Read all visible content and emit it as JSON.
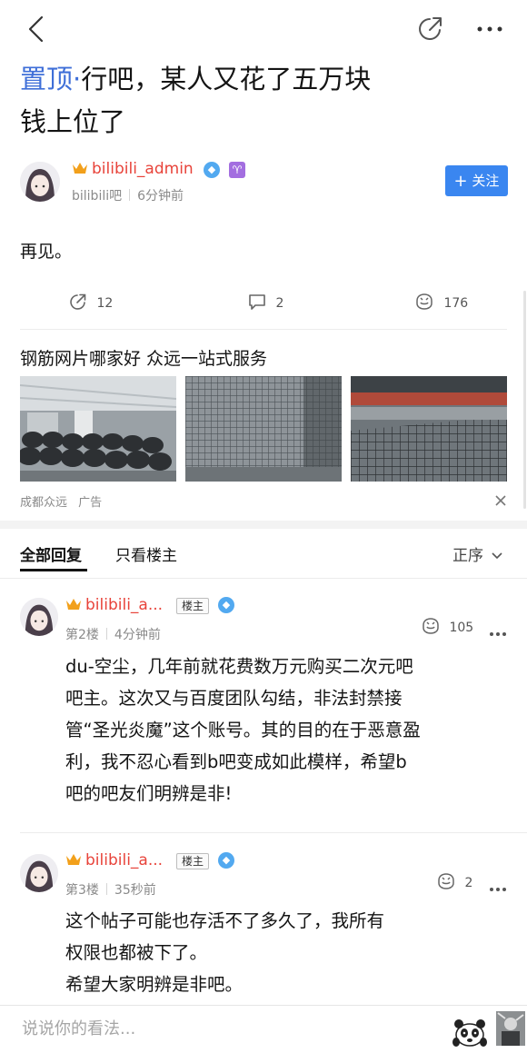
{
  "nav": {
    "back_icon": "chevron-left-icon",
    "share_icon": "share-arrow-icon",
    "more_icon": "more-dots-icon"
  },
  "post": {
    "pin_label": "置顶·",
    "title_line1": "行吧，某人又花了五万块",
    "title_line2": "钱上位了",
    "author": {
      "name": "bilibili_admin",
      "forum": "bilibili吧",
      "time": "6分钟前",
      "zodiac": "♈"
    },
    "follow_label": "关注",
    "content": "再见。",
    "stats": {
      "shares": "12",
      "comments": "2",
      "likes": "176"
    }
  },
  "ad": {
    "title": "钢筋网片哪家好  众远一站式服务",
    "advertiser": "成都众远",
    "ad_label": "广告"
  },
  "tabs": {
    "all_replies": "全部回复",
    "op_only": "只看楼主",
    "sort": "正序"
  },
  "replies": [
    {
      "name": "bilibili_a...",
      "lz_badge": "楼主",
      "floor": "第2楼",
      "time": "4分钟前",
      "likes": "105",
      "lines": [
        "du-空尘，几年前就花费数万元购买二次元吧",
        "吧主。这次又与百度团队勾结，非法封禁接",
        "管“圣光炎魔”这个账号。其的目的在于恶意盈",
        "利，我不忍心看到b吧变成如此模样，希望b",
        "吧的吧友们明辨是非!"
      ]
    },
    {
      "name": "bilibili_a...",
      "lz_badge": "楼主",
      "floor": "第3楼",
      "time": "35秒前",
      "likes": "2",
      "lines": [
        "这个帖子可能也存活不了多久了，我所有",
        "权限也都被下了。",
        "希望大家明辨是非吧。"
      ]
    }
  ],
  "input": {
    "placeholder": "说说你的看法..."
  },
  "colors": {
    "accent_blue": "#3a86f0",
    "pin_blue": "#3f6fd8",
    "author_red": "#e8433a",
    "crown_gold": "#f2a01b"
  }
}
